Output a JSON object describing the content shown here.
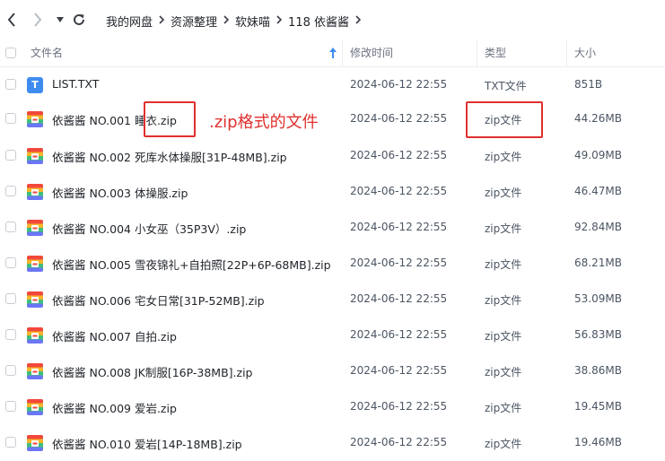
{
  "breadcrumb": [
    "我的网盘",
    "资源整理",
    "软妹喵",
    "118 依酱酱"
  ],
  "columns": {
    "name": "文件名",
    "modified": "修改时间",
    "type": "类型",
    "size": "大小"
  },
  "files": [
    {
      "name": "LIST.TXT",
      "date": "2024-06-12 22:55",
      "type": "TXT文件",
      "size": "851B",
      "icon": "txt-file-icon"
    },
    {
      "name": "依酱酱 NO.001 睡衣.zip",
      "date": "2024-06-12 22:55",
      "type": "zip文件",
      "size": "44.26MB",
      "icon": "zip-archive-icon"
    },
    {
      "name": "依酱酱 NO.002 死库水体操服[31P-48MB].zip",
      "date": "2024-06-12 22:55",
      "type": "zip文件",
      "size": "49.09MB",
      "icon": "zip-archive-icon"
    },
    {
      "name": "依酱酱 NO.003 体操服.zip",
      "date": "2024-06-12 22:55",
      "type": "zip文件",
      "size": "46.47MB",
      "icon": "zip-archive-icon"
    },
    {
      "name": "依酱酱 NO.004 小女巫（35P3V）.zip",
      "date": "2024-06-12 22:55",
      "type": "zip文件",
      "size": "92.84MB",
      "icon": "zip-archive-icon"
    },
    {
      "name": "依酱酱 NO.005 雪夜锦礼+自拍照[22P+6P-68MB].zip",
      "date": "2024-06-12 22:55",
      "type": "zip文件",
      "size": "68.21MB",
      "icon": "zip-archive-icon"
    },
    {
      "name": "依酱酱 NO.006 宅女日常[31P-52MB].zip",
      "date": "2024-06-12 22:55",
      "type": "zip文件",
      "size": "53.09MB",
      "icon": "zip-archive-icon"
    },
    {
      "name": "依酱酱 NO.007 自拍.zip",
      "date": "2024-06-12 22:55",
      "type": "zip文件",
      "size": "56.83MB",
      "icon": "zip-archive-icon"
    },
    {
      "name": "依酱酱 NO.008 JK制服[16P-38MB].zip",
      "date": "2024-06-12 22:55",
      "type": "zip文件",
      "size": "38.86MB",
      "icon": "zip-archive-icon"
    },
    {
      "name": "依酱酱 NO.009 爱岩.zip",
      "date": "2024-06-12 22:55",
      "type": "zip文件",
      "size": "19.45MB",
      "icon": "zip-archive-icon"
    },
    {
      "name": "依酱酱 NO.010 爱岩[14P-18MB].zip",
      "date": "2024-06-12 22:55",
      "type": "zip文件",
      "size": "19.46MB",
      "icon": "zip-archive-icon"
    }
  ],
  "annotation": {
    "text": ".zip格式的文件",
    "color": "#e0302d"
  },
  "colors": {
    "accent": "#3f8cf0",
    "zip_icon": [
      "#f2483b",
      "#f9b529",
      "#3fbf7b",
      "#6b76f6"
    ]
  }
}
